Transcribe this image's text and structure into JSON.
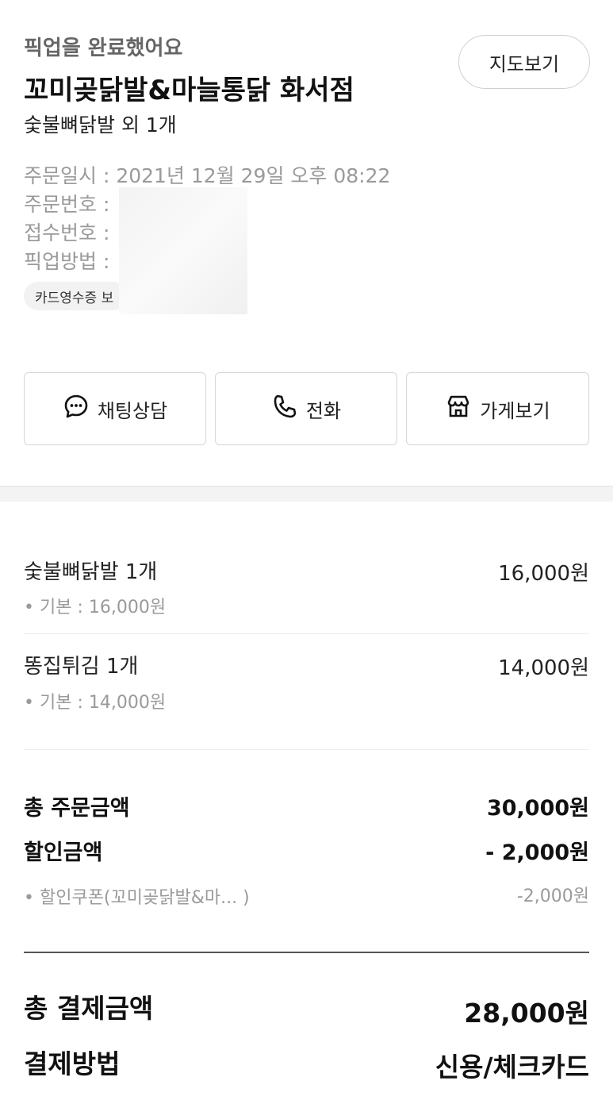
{
  "header": {
    "status": "픽업을 완료했어요",
    "store_name": "꼬미곶닭발&마늘통닭 화서점",
    "order_summary": "숯불뼈닭발 외 1개",
    "map_button": "지도보기"
  },
  "order_info": {
    "date_label": "주문일시 : ",
    "date_value": "2021년 12월 29일 오후 08:22",
    "order_no_label": "주문번호 :",
    "receipt_no_label": "접수번호 :",
    "pickup_method_label": "픽업방법 :",
    "card_receipt_chip": "카드영수증 보"
  },
  "actions": [
    {
      "label": "채팅상담",
      "icon": "chat-bubble-icon"
    },
    {
      "label": "전화",
      "icon": "phone-icon"
    },
    {
      "label": "가게보기",
      "icon": "store-icon"
    }
  ],
  "items": [
    {
      "name": "숯불뼈닭발 1개",
      "price": "16,000원",
      "option": "• 기본 : 16,000원"
    },
    {
      "name": "똥집튀김 1개",
      "price": "14,000원",
      "option": "• 기본 : 14,000원"
    }
  ],
  "totals": {
    "order_total_label": "총 주문금액",
    "order_total_value": "30,000원",
    "discount_label": "할인금액",
    "discount_value": "- 2,000원",
    "coupon_label": "• 할인쿠폰(꼬미곶닭발&마...  )",
    "coupon_value": "-2,000원",
    "payment_total_label": "총 결제금액",
    "payment_total_value": "28,000원",
    "payment_method_label": "결제방법",
    "payment_method_value": "신용/체크카드"
  }
}
